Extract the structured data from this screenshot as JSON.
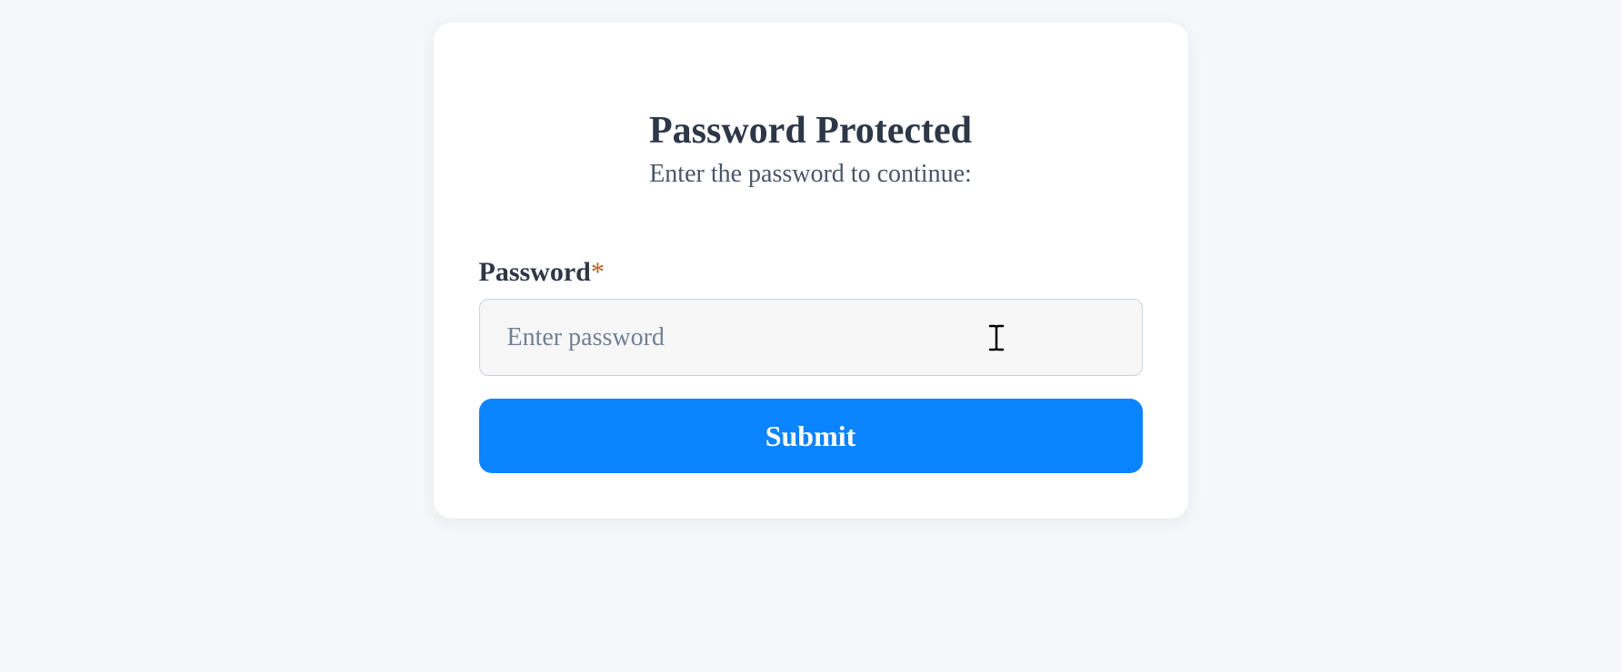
{
  "card": {
    "title": "Password Protected",
    "subtitle": "Enter the password to continue:",
    "field": {
      "label": "Password",
      "required_mark": "*",
      "placeholder": "Enter password",
      "value": ""
    },
    "submit_label": "Submit"
  }
}
